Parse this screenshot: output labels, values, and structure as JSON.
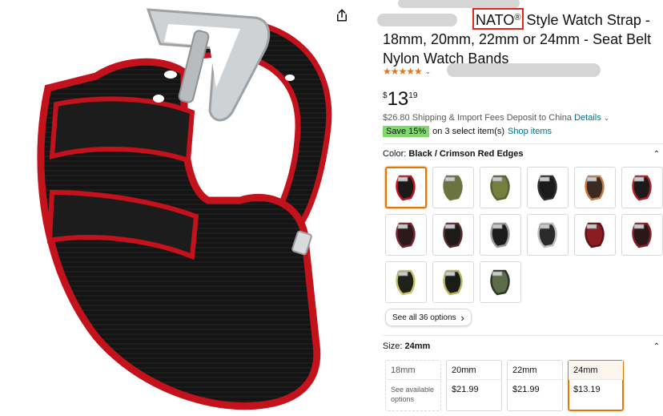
{
  "product": {
    "title_highlight": "NATO",
    "title_reg_mark": "®",
    "title_line1_rest": "Style Watch Strap -",
    "title_line2": "18mm, 20mm, 22mm or 24mm - Seat Belt",
    "title_line3": "Nylon Watch Bands",
    "stars_display": "★★★★★",
    "rating_chevron": "⌄",
    "price_symbol": "$",
    "price_whole": "13",
    "price_fraction": "19",
    "shipping_text": "$26.80 Shipping & Import Fees Deposit to China",
    "shipping_link": "Details",
    "promo_badge": "Save 15%",
    "promo_text": "on 3 select item(s)",
    "promo_link": "Shop items"
  },
  "color_section": {
    "label": "Color:",
    "selected": "Black / Crimson Red Edges",
    "see_all": "See all 36 options",
    "see_all_chevron": "›",
    "swatches": [
      {
        "color": "#1a1a1a",
        "accent": "#c3121c",
        "selected": true
      },
      {
        "color": "#6b7440",
        "accent": "#6b7440"
      },
      {
        "color": "#75803f",
        "accent": "#5a6230"
      },
      {
        "color": "#1b1b1b",
        "accent": "#2e2e2e"
      },
      {
        "color": "#3a2a22",
        "accent": "#c57b48"
      },
      {
        "color": "#1a1a1a",
        "accent": "#b01e28"
      },
      {
        "color": "#2a1a1c",
        "accent": "#7a2430"
      },
      {
        "color": "#1e1a1a",
        "accent": "#5a2a2a"
      },
      {
        "color": "#1b1b1b",
        "accent": "#9a9a9a"
      },
      {
        "color": "#2a2a2a",
        "accent": "#bdbdbd"
      },
      {
        "color": "#8a1c22",
        "accent": "#5c1216"
      },
      {
        "color": "#2a1818",
        "accent": "#8c1e26"
      },
      {
        "color": "#1e2218",
        "accent": "#c9c46a"
      },
      {
        "color": "#1a1c18",
        "accent": "#b8b45e"
      },
      {
        "color": "#5c6b48",
        "accent": "#2d3624"
      }
    ]
  },
  "size_section": {
    "label": "Size:",
    "selected": "24mm",
    "options": [
      {
        "name": "18mm",
        "price": "See available options",
        "state": "unavailable"
      },
      {
        "name": "20mm",
        "price": "$21.99",
        "state": "available"
      },
      {
        "name": "22mm",
        "price": "$21.99",
        "state": "available"
      },
      {
        "name": "24mm",
        "price": "$13.19",
        "state": "selected"
      }
    ]
  },
  "icons": {
    "share": "share-icon",
    "collapse": "chevron-up-icon"
  },
  "colors": {
    "accent_orange": "#e77600",
    "link_teal": "#007185",
    "star": "#de7921",
    "highlight_box": "#e3261c",
    "promo_green": "#7fda69"
  }
}
